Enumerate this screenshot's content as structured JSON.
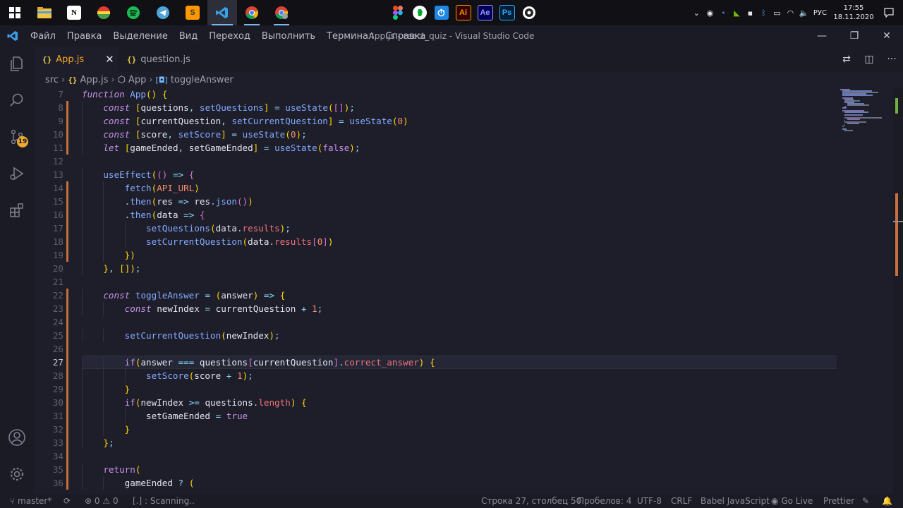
{
  "taskbar": {
    "pinned_apps": [
      "start-icon",
      "file-explorer-icon",
      "notion-icon",
      "chrome-colored-icon",
      "spotify-icon",
      "telegram-icon",
      "sublime-text-icon",
      "vscode-icon",
      "chrome-icon",
      "chrome-profile-icon"
    ],
    "center_apps": [
      {
        "name": "figma-icon",
        "label": ""
      },
      {
        "name": "evernote-icon",
        "label": ""
      },
      {
        "name": "timer-icon",
        "label": ""
      },
      {
        "name": "illustrator-icon",
        "label": "Ai"
      },
      {
        "name": "after-effects-icon",
        "label": "Ae"
      },
      {
        "name": "photoshop-icon",
        "label": "Ps"
      },
      {
        "name": "obs-icon",
        "label": ""
      }
    ],
    "tray": {
      "language": "РУС",
      "time": "17:55",
      "date": "18.11.2020"
    }
  },
  "window": {
    "menu": [
      "Файл",
      "Правка",
      "Выделение",
      "Вид",
      "Переход",
      "Выполнить",
      "Терминал",
      "Справка"
    ],
    "title": "App.js - react_quiz - Visual Studio Code"
  },
  "activity_bar": {
    "source_control_badge": "19"
  },
  "tabs": [
    {
      "label": "App.js",
      "active": true,
      "icon": "{}"
    },
    {
      "label": "question.js",
      "active": false,
      "icon": "{}"
    }
  ],
  "breadcrumb": {
    "folder": "src",
    "file": "App.js",
    "component": "App",
    "symbol": "toggleAnswer"
  },
  "editor": {
    "first_line": 7,
    "current_line": 27,
    "lines": [
      "function App() {",
      "    const [questions, setQuestions] = useState([]);",
      "    const [currentQuestion, setCurrentQuestion] = useState(0)",
      "    const [score, setScore] = useState(0);",
      "    let [gameEnded, setGameEnded] = useState(false);",
      "",
      "    useEffect(() => {",
      "        fetch(API_URL)",
      "        .then(res => res.json())",
      "        .then(data => {",
      "            setQuestions(data.results);",
      "            setCurrentQuestion(data.results[0])",
      "        })",
      "    }, []);",
      "",
      "    const toggleAnswer = (answer) => {",
      "        const newIndex = currentQuestion + 1;",
      "",
      "        setCurrentQuestion(newIndex);",
      "",
      "        if(answer === questions[currentQuestion].correct_answer) {",
      "            setScore(score + 1);",
      "        }",
      "        if(newIndex >= questions.length) {",
      "            setGameEnded = true",
      "        }",
      "    };",
      "",
      "    return(",
      "        gameEnded ? ("
    ]
  },
  "statusbar": {
    "branch": "master*",
    "errors": "0",
    "warnings": "0",
    "scanning": "[.] : Scanning..",
    "position": "Строка 27, столбец 50",
    "spaces": "Пробелов: 4",
    "encoding": "UTF-8",
    "eol": "CRLF",
    "language": "Babel JavaScript",
    "golive": "Go Live",
    "prettier": "Prettier"
  },
  "colors": {
    "accent_tab": "#f5a623",
    "keyword": "#c792ea",
    "function": "#82aaff",
    "number": "#f78c6c",
    "badge": "#f0a832"
  }
}
